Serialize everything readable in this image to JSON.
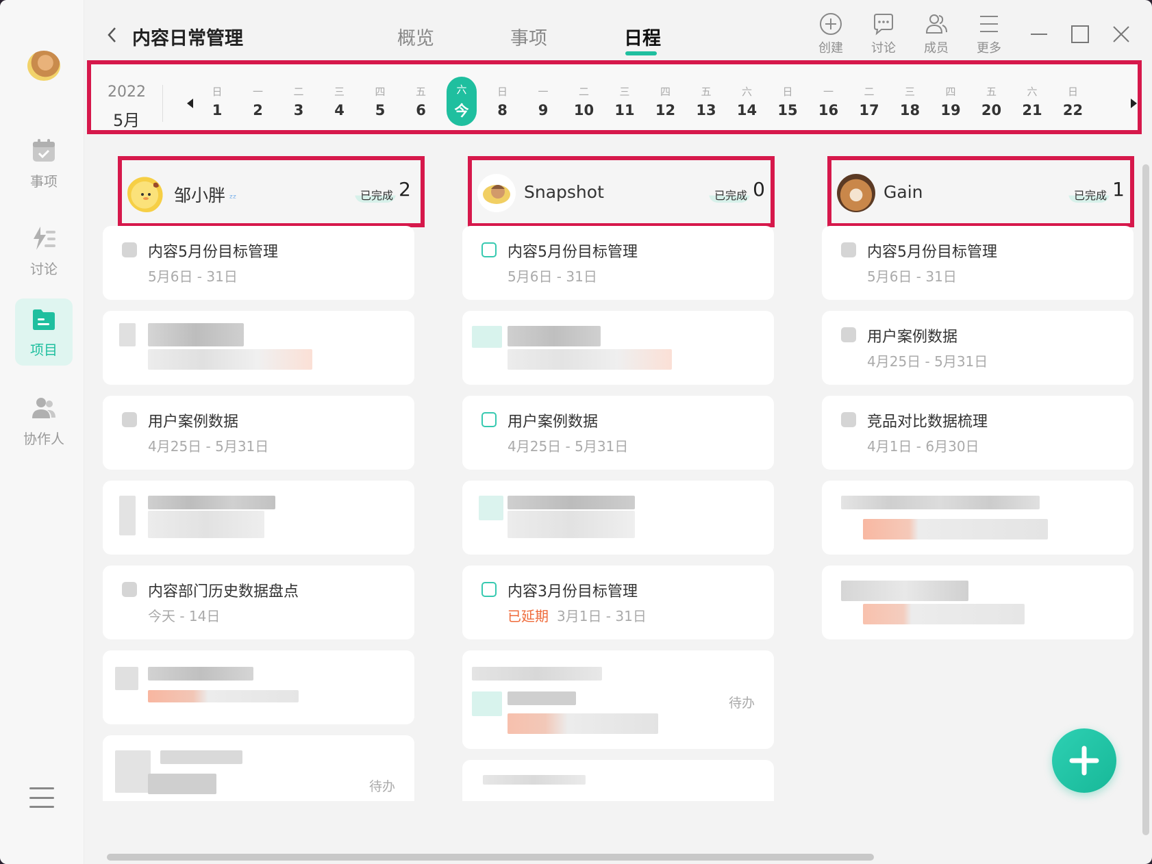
{
  "sidebar": {
    "items": [
      {
        "label": "事项",
        "icon": "calendar-check-icon"
      },
      {
        "label": "讨论",
        "icon": "bolt-list-icon"
      },
      {
        "label": "项目",
        "icon": "folder-icon"
      },
      {
        "label": "协作人",
        "icon": "people-icon"
      }
    ],
    "active": "项目"
  },
  "header": {
    "title": "内容日常管理",
    "tabs": [
      "概览",
      "事项",
      "日程"
    ],
    "active_tab": "日程",
    "tools": [
      "创建",
      "讨论",
      "成员",
      "更多"
    ]
  },
  "calendar": {
    "year": "2022",
    "month": "5月",
    "days": [
      {
        "wd": "日",
        "d": "1"
      },
      {
        "wd": "一",
        "d": "2"
      },
      {
        "wd": "二",
        "d": "3"
      },
      {
        "wd": "三",
        "d": "4"
      },
      {
        "wd": "四",
        "d": "5"
      },
      {
        "wd": "五",
        "d": "6"
      },
      {
        "wd": "六",
        "d": "今"
      },
      {
        "wd": "日",
        "d": "8"
      },
      {
        "wd": "一",
        "d": "9"
      },
      {
        "wd": "二",
        "d": "10"
      },
      {
        "wd": "三",
        "d": "11"
      },
      {
        "wd": "四",
        "d": "12"
      },
      {
        "wd": "五",
        "d": "13"
      },
      {
        "wd": "六",
        "d": "14"
      },
      {
        "wd": "日",
        "d": "15"
      },
      {
        "wd": "一",
        "d": "16"
      },
      {
        "wd": "二",
        "d": "17"
      },
      {
        "wd": "三",
        "d": "18"
      },
      {
        "wd": "四",
        "d": "19"
      },
      {
        "wd": "五",
        "d": "20"
      },
      {
        "wd": "六",
        "d": "21"
      },
      {
        "wd": "日",
        "d": "22"
      }
    ]
  },
  "columns": [
    {
      "name": "邹小胖",
      "done_label": "已完成",
      "done_count": "2",
      "cards": {
        "c1": {
          "title": "内容5月份目标管理",
          "date": "5月6日 - 31日"
        },
        "c3": {
          "title": "用户案例数据",
          "date": "4月25日 - 5月31日"
        },
        "c5": {
          "title": "内容部门历史数据盘点",
          "date": "今天 - 14日"
        },
        "c7": {
          "tag": "待办"
        }
      }
    },
    {
      "name": "Snapshot",
      "done_label": "已完成",
      "done_count": "0",
      "cards": {
        "c1": {
          "title": "内容5月份目标管理",
          "date": "5月6日 - 31日"
        },
        "c3": {
          "title": "用户案例数据",
          "date": "4月25日 - 5月31日"
        },
        "c5": {
          "title": "内容3月份目标管理",
          "overdue": "已延期",
          "date": "3月1日 - 31日"
        },
        "c6": {
          "tag": "待办"
        }
      }
    },
    {
      "name": "Gain",
      "done_label": "已完成",
      "done_count": "1",
      "cards": {
        "c1": {
          "title": "内容5月份目标管理",
          "date": "5月6日 - 31日"
        },
        "c2": {
          "title": "用户案例数据",
          "date": "4月25日 - 5月31日"
        },
        "c3": {
          "title": "竞品对比数据梳理",
          "date": "4月1日 - 6月30日"
        }
      }
    }
  ],
  "colors": {
    "accent": "#1fbf9f",
    "highlight_border": "#d6184b",
    "overdue": "#ef6a3a"
  }
}
